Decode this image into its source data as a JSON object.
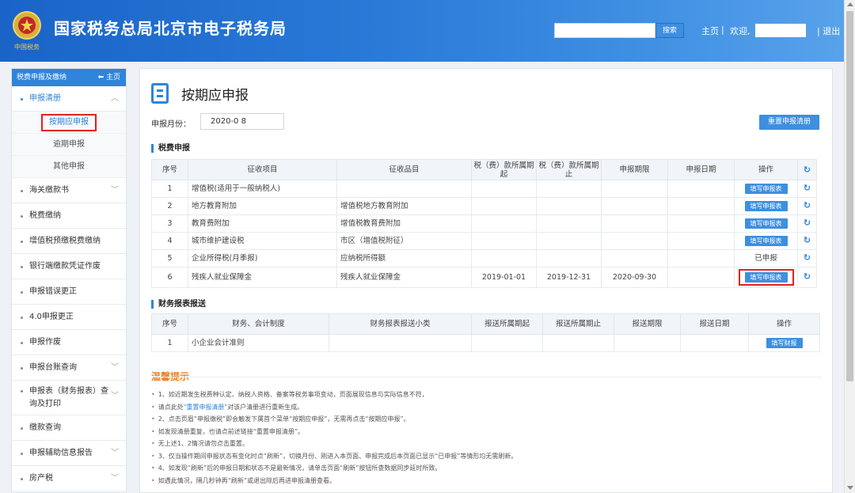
{
  "header": {
    "site_title": "国家税务总局北京市电子税务局",
    "logo_caption": "中国税务",
    "search_label": "搜索",
    "home_label": "主页",
    "separator": "|",
    "welcome_label": "欢迎,",
    "logout_label": "| 退出"
  },
  "sidebar": {
    "header_label": "税费申报及缴纳",
    "home_link": "主页",
    "section_declare": "申报清册",
    "sub_items": [
      "按期应申报",
      "逾期申报",
      "其他申报"
    ],
    "items": [
      "海关缴款书",
      "税费缴纳",
      "增值税预缴税费缴纳",
      "银行端缴款凭证作废",
      "申报错误更正",
      "4.0申报更正",
      "申报作废",
      "申报台账查询"
    ],
    "tall_item": "申报表（财务报表）查询及打印",
    "items_bottom": [
      "缴款查询",
      "申报辅助信息报告",
      "房产税"
    ]
  },
  "main": {
    "page_title": "按期应申报",
    "month_label": "申报月份：",
    "month_value": "2020-0 8",
    "reset_button": "重置申报清册",
    "tax_section_title": "税费申报",
    "tax_headers": [
      "序号",
      "征收项目",
      "征收品目",
      "税（费）款所属期起",
      "税（费）款所属期止",
      "申报期限",
      "申报日期",
      "操作"
    ],
    "tax_rows": [
      {
        "no": "1",
        "item": "增值税(适用于一般纳税人)",
        "category": "",
        "start": "",
        "end": "",
        "deadline": "",
        "date": "",
        "action": "填写申报表",
        "declared": ""
      },
      {
        "no": "2",
        "item": "地方教育附加",
        "category": "增值税地方教育附加",
        "start": "",
        "end": "",
        "deadline": "",
        "date": "",
        "action": "填写申报表",
        "declared": ""
      },
      {
        "no": "3",
        "item": "教育费附加",
        "category": "增值税教育费附加",
        "start": "",
        "end": "",
        "deadline": "",
        "date": "",
        "action": "填写申报表",
        "declared": ""
      },
      {
        "no": "4",
        "item": "城市维护建设税",
        "category": "市区（增值税附征）",
        "start": "",
        "end": "",
        "deadline": "",
        "date": "",
        "action": "填写申报表",
        "declared": ""
      },
      {
        "no": "5",
        "item": "企业所得税(月季报)",
        "category": "应纳税所得额",
        "start": "",
        "end": "",
        "deadline": "",
        "date": "",
        "action": "",
        "declared": "已申报"
      },
      {
        "no": "6",
        "item": "残疾人就业保障金",
        "category": "残疾人就业保障金",
        "start": "2019-01-01",
        "end": "2019-12-31",
        "deadline": "2020-09-30",
        "date": "",
        "action": "填写申报表",
        "declared": ""
      }
    ],
    "fin_section_title": "财务报表报送",
    "fin_headers": [
      "序号",
      "财务、会计制度",
      "财务报表报送小类",
      "报送所属期起",
      "报送所属期止",
      "报送期限",
      "报送日期",
      "操作"
    ],
    "fin_rows": [
      {
        "no": "1",
        "system": "小企业会计准则",
        "subclass": "",
        "start": "",
        "end": "",
        "deadline": "",
        "date": "",
        "action": "填写财报"
      }
    ],
    "tips_title": "温馨提示",
    "tips": [
      {
        "pre": "1、如近期发生税费种认定、纳税人资格、备案等税务事项变动，页面展现信息与实际信息不符，",
        "link": "",
        "post": ""
      },
      {
        "pre": "请点此处",
        "link": "\"重置申报清册\"",
        "post": "对该户清册进行重新生成。"
      },
      {
        "pre": "2、点击页眉“申报缴税”即会触发下属首个菜单“按期应申报”，无需再点击“按期应申报”。",
        "link": "",
        "post": ""
      },
      {
        "pre": "如发现清册重复，也请点前述链接“重置申报清册”。",
        "link": "",
        "post": ""
      },
      {
        "pre": "无上述1、2情况请勿点击重置。",
        "link": "",
        "post": ""
      },
      {
        "pre": "3、仅当操作期间申报状态有变化时点“刷新”，切换月份、刚进入本页面、申报完成后本页面已显示“已申报”等情形均无需刷新。",
        "link": "",
        "post": ""
      },
      {
        "pre": "4、如发现“刷新”后的申报日期和状态不是最新情况，请单击页面“刷新”按钮所查数据同步延时所致。",
        "link": "",
        "post": ""
      },
      {
        "pre": "如遇此情况，隔几秒钟再“刷新”或退出除后再进申报清册查看。",
        "link": "",
        "post": ""
      }
    ]
  },
  "colors": {
    "brand_blue": "#2f84db",
    "highlight_red": "#e0241b",
    "tips_orange": "#e8842b"
  }
}
